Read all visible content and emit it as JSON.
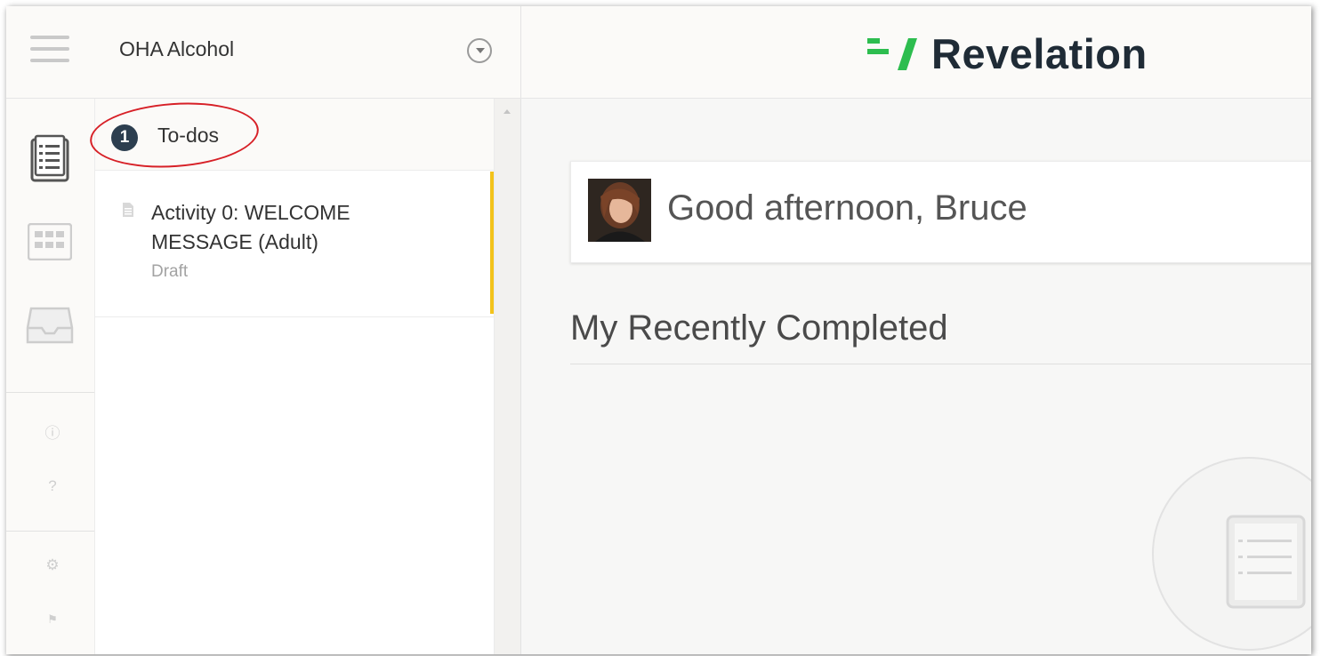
{
  "header": {
    "menu_icon": "hamburger-icon",
    "project_name": "OHA Alcohol",
    "project_dropdown_icon": "chevron-down-circle-icon",
    "brand_logo_icon": "revelation-logo-icon",
    "brand_name": "Revelation",
    "brand_color": "#2dbd4f"
  },
  "rail": {
    "items": [
      {
        "icon": "clipboard-list-icon",
        "active": true
      },
      {
        "icon": "calendar-grid-icon",
        "active": false
      },
      {
        "icon": "inbox-tray-icon",
        "active": false
      },
      {
        "icon": "info-icon",
        "active": false
      },
      {
        "icon": "help-icon",
        "active": false
      },
      {
        "icon": "settings-gear-icon",
        "active": false
      },
      {
        "icon": "language-icon",
        "active": false
      }
    ]
  },
  "todos": {
    "count": "1",
    "title": "To-dos",
    "accent_color": "#f3c31b",
    "items": [
      {
        "icon": "document-icon",
        "title": "Activity 0: WELCOME MESSAGE (Adult)",
        "status": "Draft"
      }
    ]
  },
  "main": {
    "greeting": "Good afternoon, Bruce",
    "avatar_icon": "user-avatar",
    "recent_title": "My Recently Completed",
    "empty_state_icon": "clipboard-empty-icon"
  }
}
